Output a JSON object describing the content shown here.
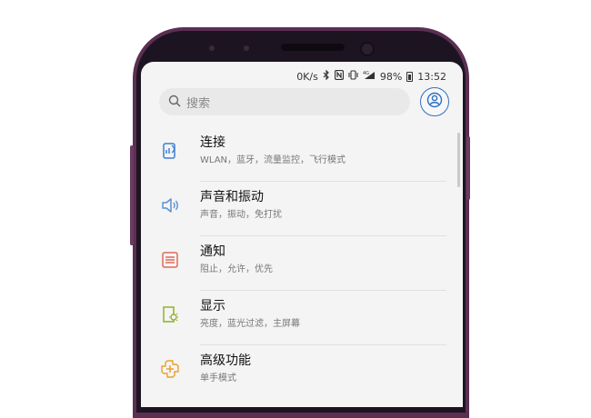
{
  "status_bar": {
    "speed": "0K/s",
    "icons": [
      "bluetooth-icon",
      "nfc-icon",
      "vibrate-icon",
      "4g-signal-icon"
    ],
    "battery": "98%",
    "time": "13:52"
  },
  "search": {
    "placeholder": "搜索"
  },
  "settings": [
    {
      "title": "连接",
      "subtitle": "WLAN，蓝牙，流量监控，飞行模式",
      "icon": "connections-icon"
    },
    {
      "title": "声音和振动",
      "subtitle": "声音，振动，免打扰",
      "icon": "speaker-icon"
    },
    {
      "title": "通知",
      "subtitle": "阻止，允许，优先",
      "icon": "notification-icon"
    },
    {
      "title": "显示",
      "subtitle": "亮度，蓝光过滤，主屏幕",
      "icon": "display-icon"
    },
    {
      "title": "高级功能",
      "subtitle": "单手模式",
      "icon": "advanced-features-icon"
    }
  ],
  "colors": {
    "accent": "#2c6fc6",
    "connections_icon": "#3a7fd5",
    "sound_icon": "#5b8fd8",
    "notification_icon": "#e06a5a",
    "display_icon": "#8fb22a",
    "advanced_icon": "#e8a12a",
    "phone_body": "#5a2f52"
  }
}
